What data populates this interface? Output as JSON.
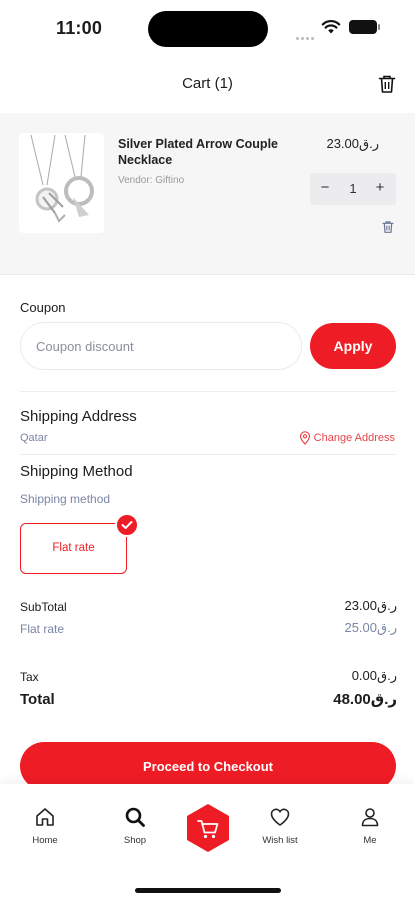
{
  "status_bar": {
    "time": "11:00"
  },
  "header": {
    "title": "Cart (1)"
  },
  "cart_item": {
    "name": "Silver Plated Arrow Couple Necklace",
    "vendor": "Vendor: Giftino",
    "price": "23.00ر.ق",
    "quantity": "1",
    "minus": "−",
    "plus": "+"
  },
  "coupon": {
    "label": "Coupon",
    "placeholder": "Coupon discount",
    "apply_label": "Apply"
  },
  "shipping": {
    "address_title": "Shipping Address",
    "country": "Qatar",
    "change_address": "Change Address",
    "method_title": "Shipping Method",
    "method_label": "Shipping method",
    "selected_method": "Flat rate"
  },
  "totals": {
    "subtotal_label": "SubTotal",
    "subtotal_value": "23.00ر.ق",
    "flat_rate_label": "Flat rate",
    "flat_rate_value": "25.00ر.ق",
    "tax_label": "Tax",
    "tax_value": "0.00ر.ق",
    "total_label": "Total",
    "total_value": "48.00ر.ق"
  },
  "checkout": {
    "label": "Proceed to Checkout"
  },
  "nav": {
    "home": "Home",
    "shop": "Shop",
    "wishlist": "Wish list",
    "me": "Me"
  },
  "colors": {
    "accent": "#ee1c25",
    "muted": "#7a86a6",
    "surface": "#f6f6f7"
  },
  "icons": [
    "trash-icon",
    "location-pin-icon",
    "check-icon",
    "home-icon",
    "search-icon",
    "cart-icon",
    "heart-icon",
    "user-icon",
    "wifi-icon",
    "battery-icon"
  ]
}
